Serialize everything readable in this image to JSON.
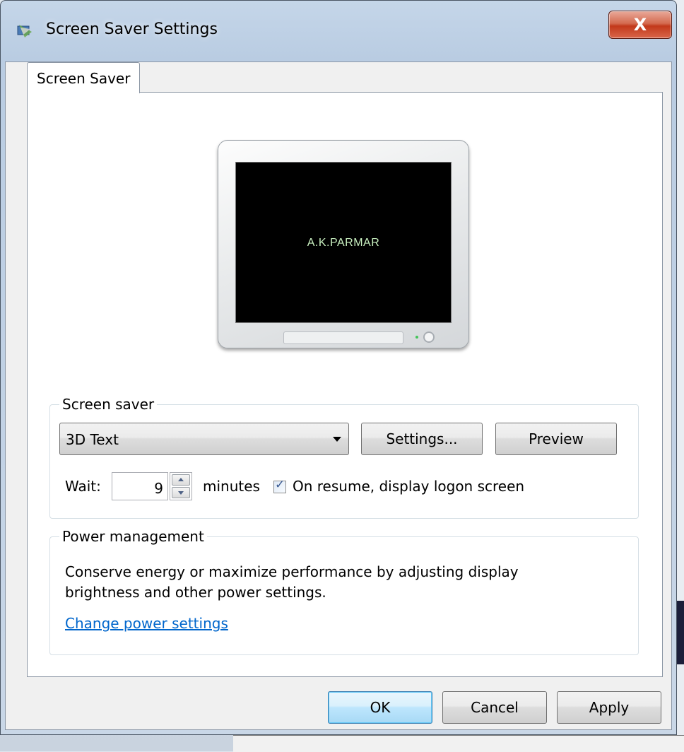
{
  "window": {
    "title": "Screen Saver Settings",
    "close_glyph": "X",
    "icon": "screen-saver-app-icon"
  },
  "tabs": [
    {
      "label": "Screen Saver",
      "selected": true
    }
  ],
  "preview": {
    "screen_text": "A.K.PARMAR"
  },
  "screen_saver_group": {
    "label": "Screen saver",
    "selected_saver": "3D Text",
    "settings_button": "Settings...",
    "preview_button": "Preview",
    "wait_label": "Wait:",
    "wait_value": "9",
    "minutes_label": "minutes",
    "resume_checked": true,
    "resume_label": "On resume, display logon screen"
  },
  "power_group": {
    "label": "Power management",
    "description": "Conserve energy or maximize performance by adjusting display brightness and other power settings.",
    "link": "Change power settings"
  },
  "footer": {
    "ok": "OK",
    "cancel": "Cancel",
    "apply": "Apply"
  },
  "colors": {
    "link": "#0066cc",
    "close_button": "#c2391b",
    "screen_text": "#c9f0c0"
  }
}
